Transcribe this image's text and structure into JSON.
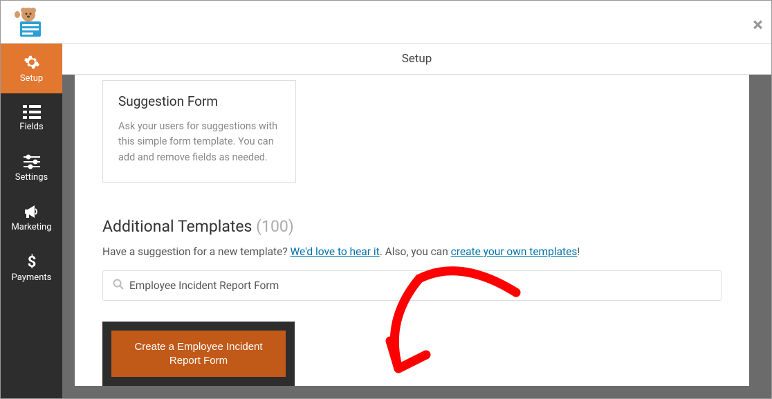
{
  "header": {
    "close_label": "×"
  },
  "sidebar": {
    "items": [
      {
        "label": "Setup",
        "icon": "gear",
        "active": true
      },
      {
        "label": "Fields",
        "icon": "list",
        "active": false
      },
      {
        "label": "Settings",
        "icon": "sliders",
        "active": false
      },
      {
        "label": "Marketing",
        "icon": "bullhorn",
        "active": false
      },
      {
        "label": "Payments",
        "icon": "dollar",
        "active": false
      }
    ]
  },
  "page_title": "Setup",
  "template_card": {
    "title": "Suggestion Form",
    "description": "Ask your users for suggestions with this simple form template. You can add and remove fields as needed."
  },
  "additional": {
    "heading": "Additional Templates",
    "count": "(100)",
    "suggestion_prefix": "Have a suggestion for a new template? ",
    "suggestion_link1": "We'd love to hear it",
    "suggestion_middle": ". Also, you can ",
    "suggestion_link2": "create your own templates",
    "suggestion_suffix": "!"
  },
  "search": {
    "value": "Employee Incident Report Form"
  },
  "create_button": {
    "label": "Create a Employee Incident Report Form"
  }
}
